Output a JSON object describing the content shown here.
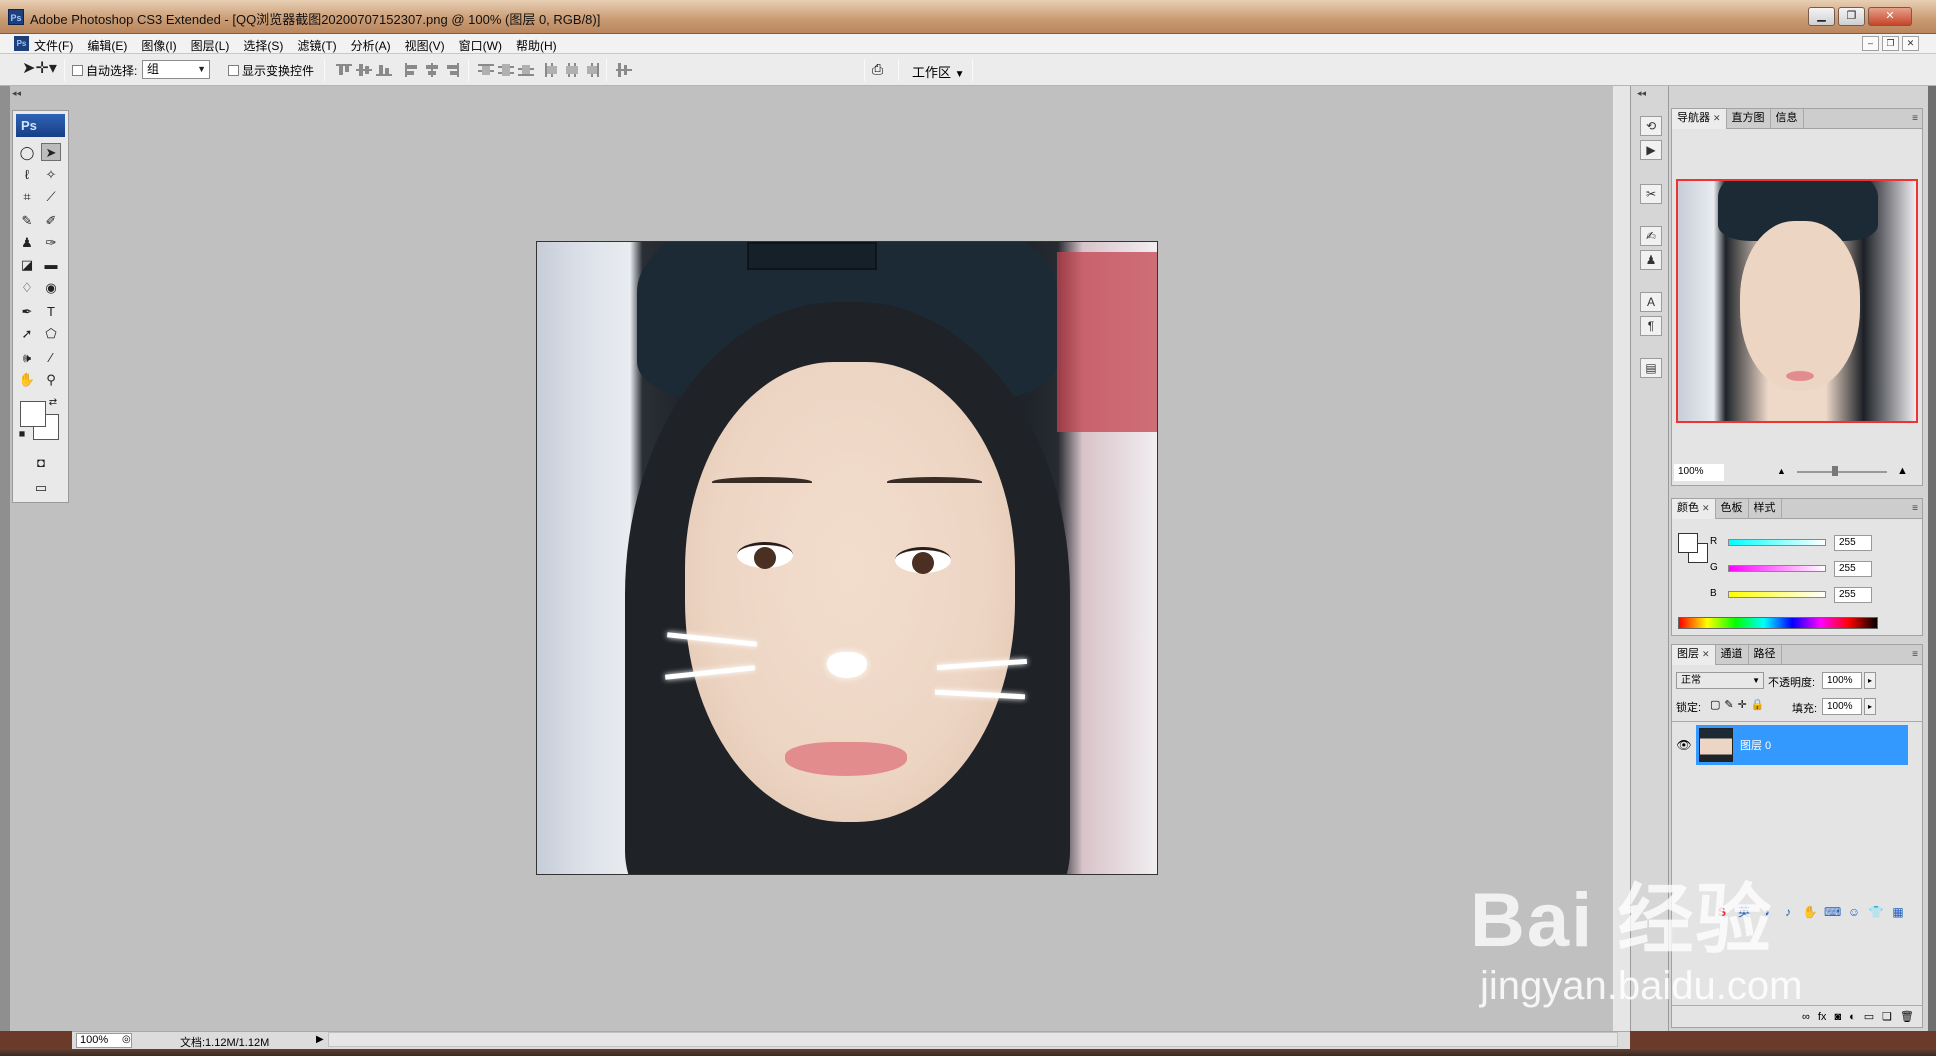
{
  "window": {
    "title": "Adobe Photoshop CS3 Extended - [QQ浏览器截图20200707152307.png @ 100% (图层 0, RGB/8)]",
    "app_icon": "Ps"
  },
  "menu": {
    "items": [
      "文件(F)",
      "编辑(E)",
      "图像(I)",
      "图层(L)",
      "选择(S)",
      "滤镜(T)",
      "分析(A)",
      "视图(V)",
      "窗口(W)",
      "帮助(H)"
    ]
  },
  "options": {
    "auto_select_label": "自动选择:",
    "auto_select_value": "组",
    "show_transform_label": "显示变换控件",
    "workspace_label": "工作区"
  },
  "toolbox": {
    "logo": "Ps"
  },
  "status": {
    "zoom": "100%",
    "doc_info": "文档:1.12M/1.12M"
  },
  "navigator": {
    "tabs": [
      "导航器",
      "直方图",
      "信息"
    ],
    "zoom": "100%"
  },
  "color_panel": {
    "tabs": [
      "颜色",
      "色板",
      "样式"
    ],
    "channels": [
      {
        "label": "R",
        "value": "255"
      },
      {
        "label": "G",
        "value": "255"
      },
      {
        "label": "B",
        "value": "255"
      }
    ]
  },
  "layers_panel": {
    "tabs": [
      "图层",
      "通道",
      "路径"
    ],
    "blend_mode": "正常",
    "opacity_label": "不透明度:",
    "opacity_value": "100%",
    "lock_label": "锁定:",
    "fill_label": "填充:",
    "fill_value": "100%",
    "layers": [
      {
        "name": "图层 0"
      }
    ]
  },
  "watermark": {
    "logo": "Bai 经验",
    "url": "jingyan.baidu.com"
  },
  "colors": {
    "selection_blue": "#3399ff",
    "ps_blue": "#1d4d9c"
  }
}
